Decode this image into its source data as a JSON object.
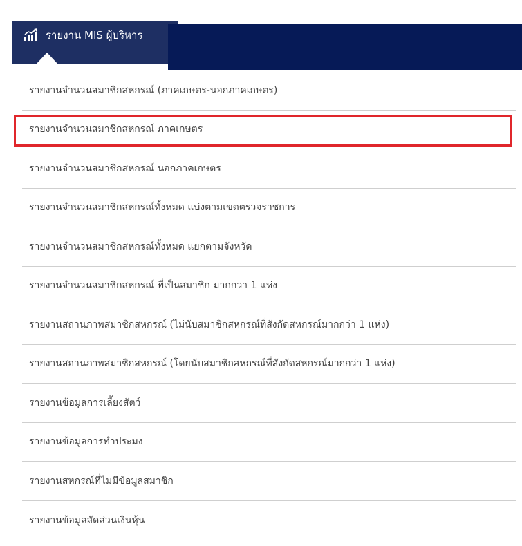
{
  "header": {
    "icon": "bar-chart-icon",
    "title": "รายงาน MIS ผู้บริหาร",
    "color": "#1e2f63"
  },
  "redaction_color": "#061a57",
  "highlight_color": "#e0262b",
  "menu": {
    "items": [
      {
        "label": "รายงานจำนวนสมาชิกสหกรณ์ (ภาคเกษตร-นอกภาคเกษตร)"
      },
      {
        "label": "รายงานจำนวนสมาชิกสหกรณ์ ภาคเกษตร",
        "highlighted": true
      },
      {
        "label": "รายงานจำนวนสมาชิกสหกรณ์ นอกภาคเกษตร"
      },
      {
        "label": "รายงานจำนวนสมาชิกสหกรณ์ทั้งหมด แบ่งตามเขตตรวจราชการ"
      },
      {
        "label": "รายงานจำนวนสมาชิกสหกรณ์ทั้งหมด แยกตามจังหวัด"
      },
      {
        "label": "รายงานจำนวนสมาชิกสหกรณ์ ที่เป็นสมาชิก มากกว่า 1 แห่ง"
      },
      {
        "label": "รายงานสถานภาพสมาชิกสหกรณ์ (ไม่นับสมาชิกสหกรณ์ที่สังกัดสหกรณ์มากกว่า 1 แห่ง)"
      },
      {
        "label": "รายงานสถานภาพสมาชิกสหกรณ์ (โดยนับสมาชิกสหกรณ์ที่สังกัดสหกรณ์มากกว่า 1 แห่ง)"
      },
      {
        "label": "รายงานข้อมูลการเลี้ยงสัตว์"
      },
      {
        "label": "รายงานข้อมูลการทำประมง"
      },
      {
        "label": "รายงานสหกรณ์ที่ไม่มีข้อมูลสมาชิก"
      },
      {
        "label": "รายงานข้อมูลสัดส่วนเงินหุ้น"
      }
    ]
  }
}
